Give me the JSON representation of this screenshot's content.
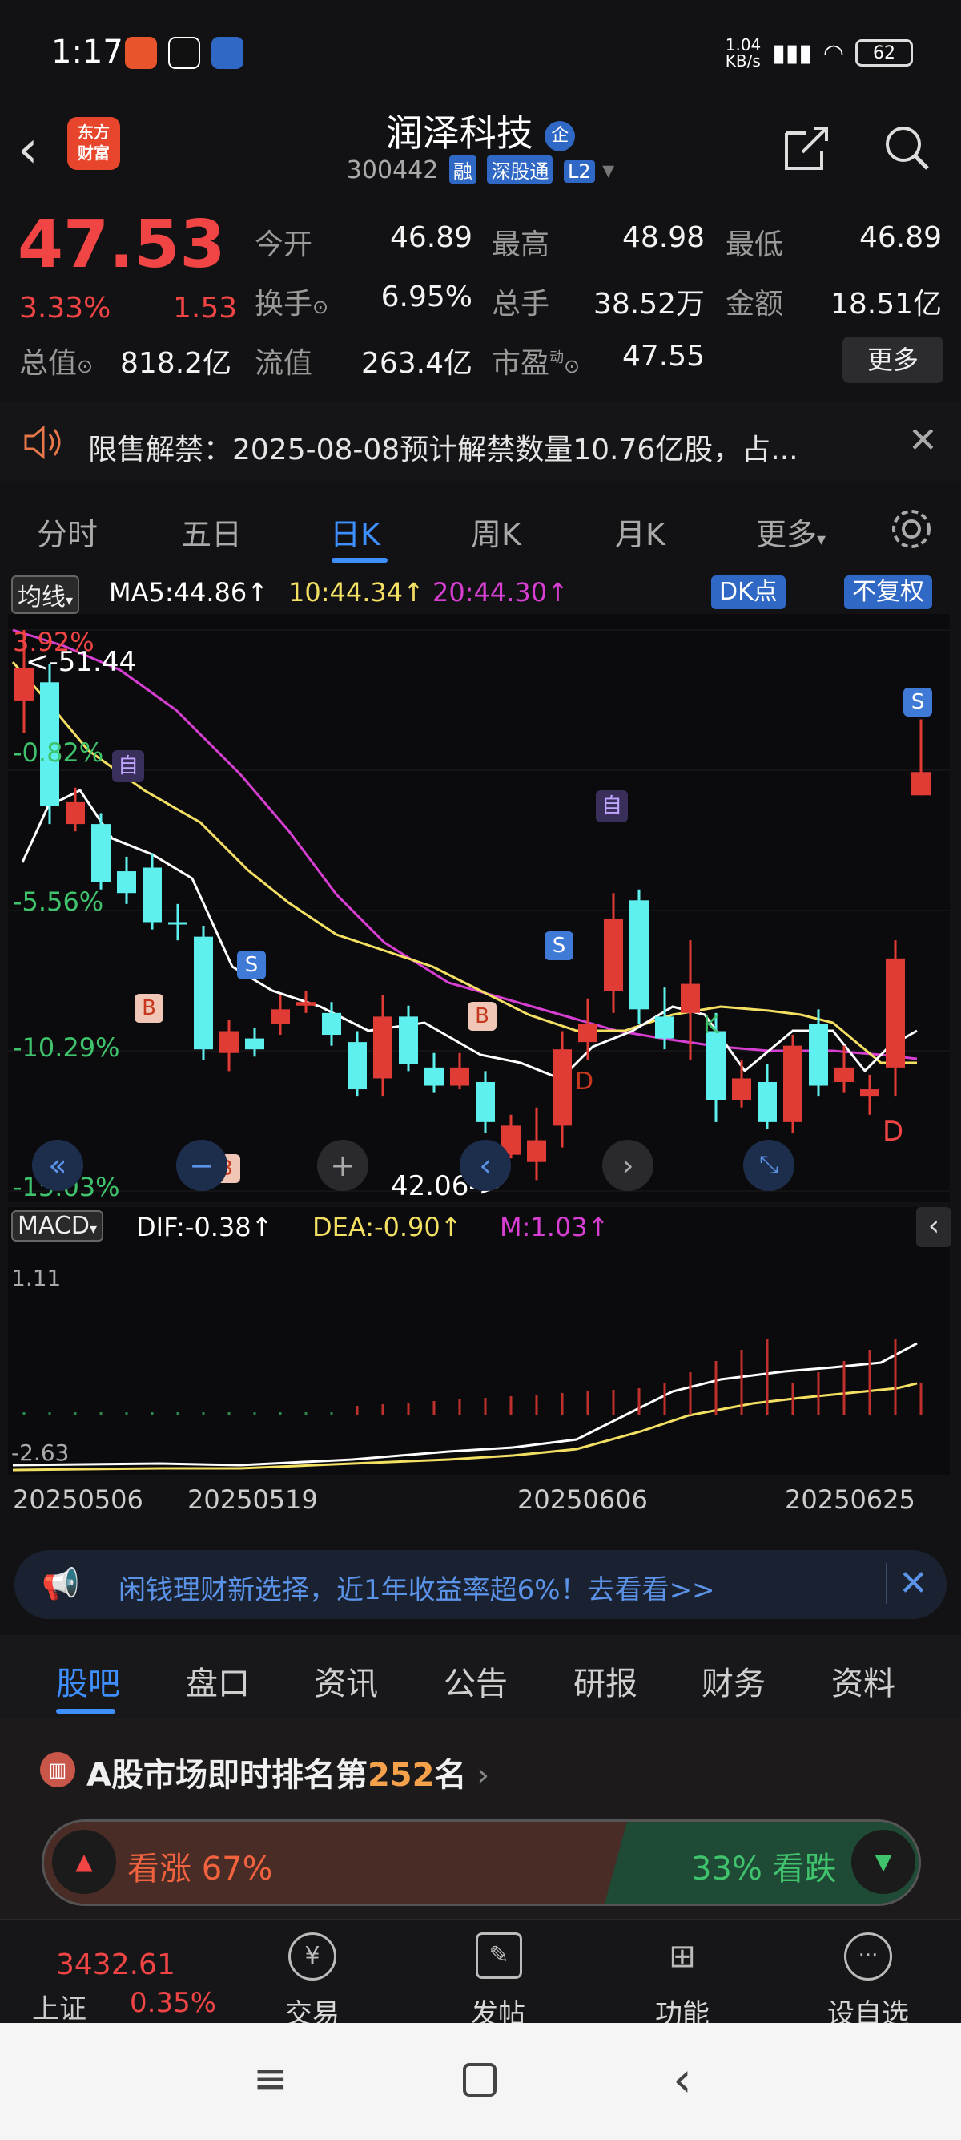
{
  "status": {
    "time": "1:17",
    "net_speed": "1.04\nKB/s",
    "battery": "62"
  },
  "header": {
    "title": "润泽科技",
    "code": "300442",
    "tags": [
      "融",
      "深股通",
      "L2"
    ],
    "logo_text": "东方\n财富"
  },
  "quote": {
    "price": "47.53",
    "change_pct": "3.33%",
    "change": "1.53",
    "open_label": "今开",
    "open": "46.89",
    "high_label": "最高",
    "high": "48.98",
    "low_label": "最低",
    "low": "46.89",
    "turnover_label": "换手",
    "turnover": "6.95%",
    "volume_label": "总手",
    "volume": "38.52万",
    "amount_label": "金额",
    "amount": "18.51亿",
    "mcap_label": "总值",
    "mcap": "818.2亿",
    "float_label": "流值",
    "float": "263.4亿",
    "pe_label": "市盈",
    "pe_sup": "动",
    "pe": "47.55",
    "more": "更多"
  },
  "notice": {
    "text": "限售解禁：2025-08-08预计解禁数量10.76亿股，占..."
  },
  "ktabs": [
    "分时",
    "五日",
    "日K",
    "周K",
    "月K",
    "更多"
  ],
  "ma": {
    "selector": "均线",
    "ma5": "MA5:44.86↑",
    "ma10": "10:44.34↑",
    "ma20": "20:44.30↑",
    "dk": "DK点",
    "fq": "不复权"
  },
  "chart_labels": {
    "pct_levels": [
      "3.92%",
      "-0.82%",
      "-5.56%",
      "-10.29%",
      "-15.03%"
    ],
    "high_mark": "<-51.44",
    "low_mark": "42.06->",
    "macd_selector": "MACD",
    "dif": "DIF:-0.38↑",
    "dea": "DEA:-0.90↑",
    "m": "M:1.03↑",
    "macd_top": "1.11",
    "macd_bottom": "-2.63",
    "dates": [
      "20250506",
      "20250519",
      "20250606",
      "20250625"
    ],
    "markers": {
      "self": "自",
      "buy": "B",
      "sell": "S",
      "d": "D",
      "k": "K"
    }
  },
  "chart_data": {
    "type": "candlestick",
    "title": "",
    "candles": [
      {
        "o": 50.4,
        "c": 49.5,
        "h": 51.44,
        "l": 48.6,
        "up": true
      },
      {
        "o": 50.0,
        "c": 46.6,
        "h": 50.5,
        "l": 46.1,
        "up": false
      },
      {
        "o": 46.7,
        "c": 46.1,
        "h": 47.1,
        "l": 45.9,
        "up": true
      },
      {
        "o": 46.1,
        "c": 44.5,
        "h": 46.4,
        "l": 44.3,
        "up": false
      },
      {
        "o": 44.8,
        "c": 44.2,
        "h": 45.2,
        "l": 43.9,
        "up": false
      },
      {
        "o": 44.9,
        "c": 43.4,
        "h": 45.3,
        "l": 43.2,
        "up": false
      },
      {
        "o": 43.4,
        "c": 43.4,
        "h": 43.9,
        "l": 42.9,
        "up": false
      },
      {
        "o": 43.0,
        "c": 39.9,
        "h": 43.3,
        "l": 39.6,
        "up": false
      },
      {
        "o": 39.8,
        "c": 40.4,
        "h": 40.7,
        "l": 39.3,
        "up": true
      },
      {
        "o": 39.9,
        "c": 40.2,
        "h": 40.5,
        "l": 39.7,
        "up": false
      },
      {
        "o": 40.6,
        "c": 41.0,
        "h": 41.4,
        "l": 40.3,
        "up": true
      },
      {
        "o": 41.1,
        "c": 41.2,
        "h": 41.5,
        "l": 40.9,
        "up": true
      },
      {
        "o": 40.9,
        "c": 40.3,
        "h": 41.2,
        "l": 40.0,
        "up": false
      },
      {
        "o": 40.1,
        "c": 38.8,
        "h": 40.4,
        "l": 38.6,
        "up": false
      },
      {
        "o": 39.1,
        "c": 40.8,
        "h": 41.4,
        "l": 38.6,
        "up": true
      },
      {
        "o": 40.8,
        "c": 39.5,
        "h": 41.1,
        "l": 39.3,
        "up": false
      },
      {
        "o": 39.4,
        "c": 38.9,
        "h": 39.8,
        "l": 38.7,
        "up": false
      },
      {
        "o": 38.9,
        "c": 39.4,
        "h": 39.8,
        "l": 38.8,
        "up": true
      },
      {
        "o": 39.0,
        "c": 37.9,
        "h": 39.3,
        "l": 37.6,
        "up": false
      },
      {
        "o": 37.8,
        "c": 37.0,
        "h": 38.1,
        "l": 36.9,
        "up": true
      },
      {
        "o": 36.8,
        "c": 37.4,
        "h": 38.3,
        "l": 36.3,
        "up": true
      },
      {
        "o": 37.8,
        "c": 39.9,
        "h": 40.4,
        "l": 37.2,
        "up": true
      },
      {
        "o": 40.1,
        "c": 40.6,
        "h": 41.3,
        "l": 39.6,
        "up": true
      },
      {
        "o": 41.5,
        "c": 43.5,
        "h": 44.2,
        "l": 40.9,
        "up": true
      },
      {
        "o": 44.0,
        "c": 41.0,
        "h": 44.3,
        "l": 40.6,
        "up": false
      },
      {
        "o": 40.8,
        "c": 40.2,
        "h": 41.6,
        "l": 39.9,
        "up": false
      },
      {
        "o": 40.9,
        "c": 41.7,
        "h": 42.9,
        "l": 39.6,
        "up": true
      },
      {
        "o": 40.4,
        "c": 38.5,
        "h": 40.9,
        "l": 37.9,
        "up": false
      },
      {
        "o": 39.1,
        "c": 38.5,
        "h": 39.6,
        "l": 38.3,
        "up": true
      },
      {
        "o": 39.0,
        "c": 37.9,
        "h": 39.5,
        "l": 37.7,
        "up": false
      },
      {
        "o": 37.9,
        "c": 40.0,
        "h": 40.3,
        "l": 37.6,
        "up": true
      },
      {
        "o": 40.6,
        "c": 38.9,
        "h": 41.0,
        "l": 38.6,
        "up": false
      },
      {
        "o": 39.0,
        "c": 39.4,
        "h": 40.0,
        "l": 38.7,
        "up": true
      },
      {
        "o": 38.8,
        "c": 38.6,
        "h": 39.2,
        "l": 38.1,
        "up": true
      },
      {
        "o": 39.4,
        "c": 42.4,
        "h": 42.9,
        "l": 38.6,
        "up": true
      },
      {
        "o": 46.89,
        "c": 47.53,
        "h": 48.98,
        "l": 46.89,
        "up": true
      }
    ]
  },
  "promo": {
    "text": "闲钱理财新选择，近1年收益率超6%！去看看>>"
  },
  "btabs": [
    "股吧",
    "盘口",
    "资讯",
    "公告",
    "研报",
    "财务",
    "资料"
  ],
  "rank": {
    "prefix": "A股市场即时排名第",
    "num": "252",
    "suffix": "名",
    "up": "看涨 67%",
    "down": "33% 看跌"
  },
  "bnav": {
    "index_val": "3432.61",
    "index_name": "上证",
    "index_pct": "0.35%",
    "items": [
      "交易",
      "发帖",
      "功能",
      "设自选"
    ]
  }
}
